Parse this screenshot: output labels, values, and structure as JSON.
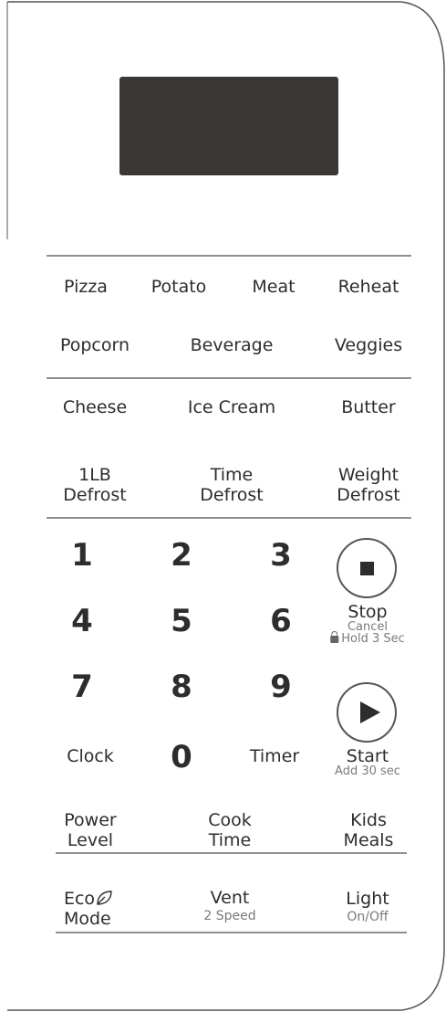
{
  "auto_cook": {
    "pizza": "Pizza",
    "potato": "Potato",
    "meat": "Meat",
    "reheat": "Reheat",
    "popcorn": "Popcorn",
    "beverage": "Beverage",
    "veggies": "Veggies"
  },
  "melt_soften": {
    "cheese": "Cheese",
    "ice_cream": "Ice Cream",
    "butter": "Butter"
  },
  "defrost": {
    "one_lb_line1": "1LB",
    "one_lb_line2": "Defrost",
    "time_line1": "Time",
    "time_line2": "Defrost",
    "weight_line1": "Weight",
    "weight_line2": "Defrost"
  },
  "keypad": {
    "k1": "1",
    "k2": "2",
    "k3": "3",
    "k4": "4",
    "k5": "5",
    "k6": "6",
    "k7": "7",
    "k8": "8",
    "k9": "9",
    "k0": "0",
    "clock": "Clock",
    "timer": "Timer"
  },
  "controls": {
    "stop": "Stop",
    "stop_sub1": "Cancel",
    "stop_sub2": "Hold 3 Sec",
    "start": "Start",
    "start_sub": "Add 30 sec"
  },
  "settings": {
    "power_line1": "Power",
    "power_line2": "Level",
    "cook_line1": "Cook",
    "cook_line2": "Time",
    "kids_line1": "Kids",
    "kids_line2": "Meals"
  },
  "extras": {
    "eco_line1": "Eco",
    "eco_line2": "Mode",
    "vent": "Vent",
    "vent_sub": "2 Speed",
    "light": "Light",
    "light_sub": "On/Off"
  }
}
